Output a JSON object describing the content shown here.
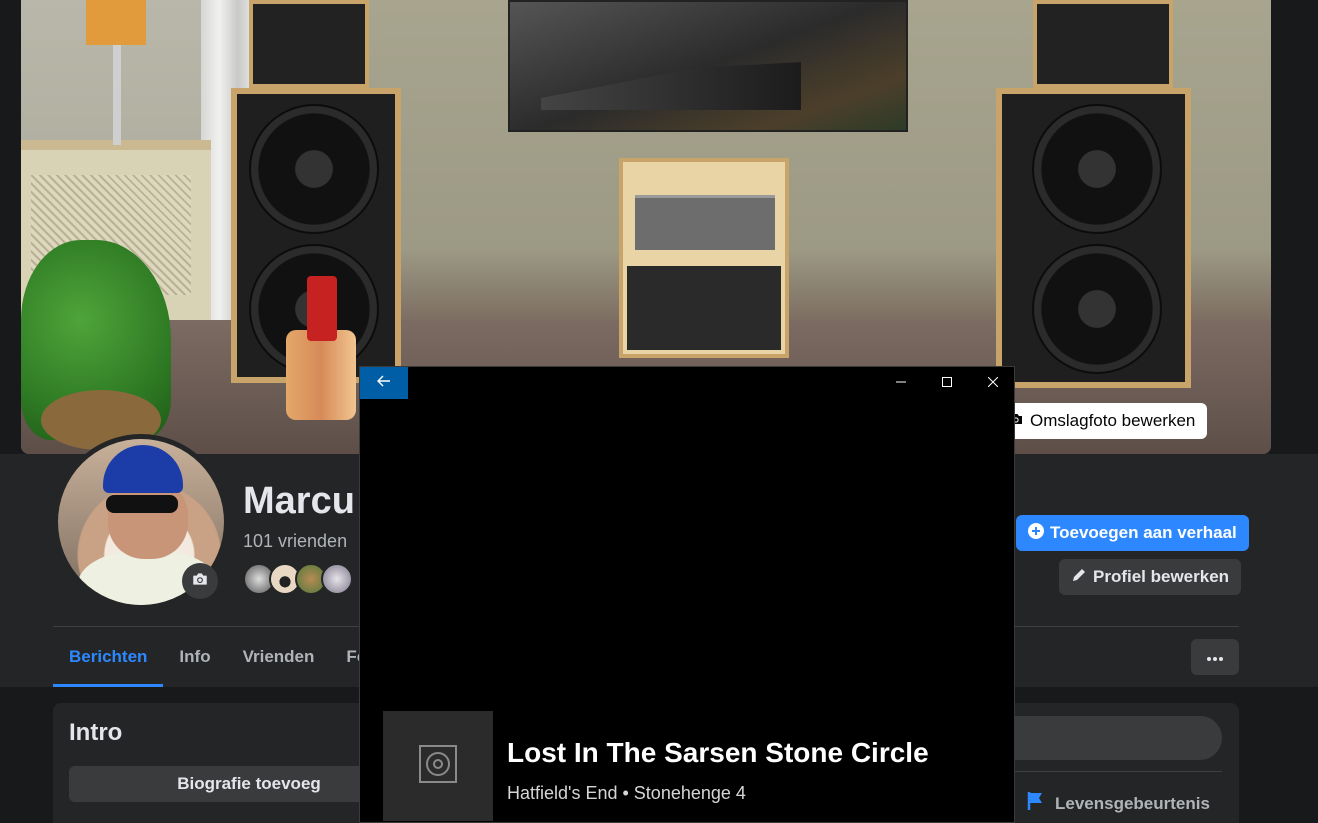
{
  "cover": {
    "edit_button_label": "Omslagfoto bewerken"
  },
  "profile": {
    "name": "Marcu",
    "friends_count": "101 vrienden"
  },
  "actions": {
    "story_label": "Toevoegen aan verhaal",
    "edit_profile_label": "Profiel bewerken"
  },
  "tabs": [
    {
      "label": "Berichten"
    },
    {
      "label": "Info"
    },
    {
      "label": "Vrienden"
    },
    {
      "label": "Fo"
    }
  ],
  "intro": {
    "title": "Intro",
    "bio_button_label": "Biografie toevoeg"
  },
  "composer": {
    "life_event_label": "Levensgebeurtenis"
  },
  "player": {
    "song_title": "Lost In The Sarsen Stone Circle",
    "song_meta": "Hatfield's End • Stonehenge 4"
  },
  "colors": {
    "accent": "#2d88ff",
    "player_back_button": "#005ea6",
    "background": "#18191a",
    "card": "#242526"
  }
}
